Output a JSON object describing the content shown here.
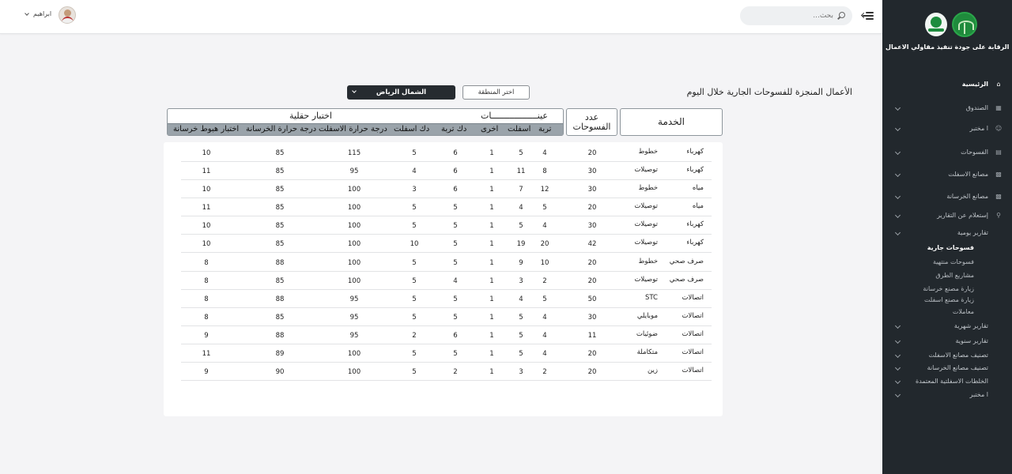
{
  "header": {
    "search_placeholder": "بحث...",
    "user_name": "ابراهيم"
  },
  "sidebar": {
    "brand_title": "الرقابة على جودة تنفيذ مقاولي الاعمال",
    "items": [
      {
        "label": "الرئيسية",
        "icon": "home-icon",
        "chevron": false
      },
      {
        "label": "الصندوق",
        "icon": "box-icon",
        "chevron": true
      },
      {
        "label": "ا مختبر",
        "icon": "lab-icon",
        "chevron": true
      },
      {
        "label": "الفسوحات",
        "icon": "document-icon",
        "chevron": true
      },
      {
        "label": "مصانع الاسفلت",
        "icon": "factory-icon",
        "chevron": true
      },
      {
        "label": "مصانع الخرسانة",
        "icon": "factory-icon",
        "chevron": true
      },
      {
        "label": "إستعلام عن التقارير",
        "icon": "search-icon",
        "chevron": true
      },
      {
        "label": "تقارير يومية",
        "icon": "",
        "chevron": true
      }
    ],
    "sub_items": [
      {
        "label": "فسوحات جارية",
        "active": true
      },
      {
        "label": "فسوحات منتهية",
        "active": false
      },
      {
        "label": "مشاريع الطرق",
        "active": false
      },
      {
        "label": "زيارة مصنع خرسانة",
        "active": false
      },
      {
        "label": "زيارة مصنع اسفلت",
        "active": false
      },
      {
        "label": "معاملات",
        "active": false
      }
    ],
    "more_items": [
      {
        "label": "تقارير شهرية"
      },
      {
        "label": "تقارير سنوية"
      },
      {
        "label": "تصنيف مصانع الاسفلت"
      },
      {
        "label": "تصنيف مصانع الخرسانة"
      },
      {
        "label": "الخلطات الاسفلتية المعتمدة"
      },
      {
        "label": "ا مختبر"
      }
    ]
  },
  "main": {
    "title": "الأعمال المنجزة للفسوحات الجارية خلال اليوم",
    "region_button": "اختر المنطقة",
    "region_selected": "الشمال الرياض",
    "headers": {
      "service": "الخدمة",
      "count_line1": "عدد",
      "count_line2": "الفسوحات",
      "samples": "عينــــــــــــــــــات",
      "field_tests": "اختبار حقلية",
      "sub": [
        "تربة",
        "اسفلت",
        "اخرى",
        "دك تربة",
        "دك اسفلت",
        "درجة حرارة الاسفلت",
        "درجة حرارة الخرسانة",
        "اختبار هبوط خرسانة"
      ]
    },
    "rows": [
      {
        "service": "كهرباء",
        "type": "خطوط",
        "count": "20",
        "soil": "4",
        "asphalt": "5",
        "other": "1",
        "soil_comp": "6",
        "asph_comp": "5",
        "asph_temp": "115",
        "conc_temp": "85",
        "slump": "10"
      },
      {
        "service": "كهرباء",
        "type": "توصيلات",
        "count": "30",
        "soil": "8",
        "asphalt": "11",
        "other": "1",
        "soil_comp": "6",
        "asph_comp": "4",
        "asph_temp": "95",
        "conc_temp": "85",
        "slump": "11"
      },
      {
        "service": "مياه",
        "type": "خطوط",
        "count": "30",
        "soil": "12",
        "asphalt": "7",
        "other": "1",
        "soil_comp": "6",
        "asph_comp": "3",
        "asph_temp": "100",
        "conc_temp": "85",
        "slump": "10"
      },
      {
        "service": "مياه",
        "type": "توصيلات",
        "count": "20",
        "soil": "5",
        "asphalt": "4",
        "other": "1",
        "soil_comp": "5",
        "asph_comp": "5",
        "asph_temp": "100",
        "conc_temp": "85",
        "slump": "11"
      },
      {
        "service": "كهرباء",
        "type": "توصيلات",
        "count": "30",
        "soil": "4",
        "asphalt": "5",
        "other": "1",
        "soil_comp": "5",
        "asph_comp": "5",
        "asph_temp": "100",
        "conc_temp": "85",
        "slump": "10"
      },
      {
        "service": "كهرباء",
        "type": "توصيلات",
        "count": "42",
        "soil": "20",
        "asphalt": "19",
        "other": "1",
        "soil_comp": "5",
        "asph_comp": "10",
        "asph_temp": "100",
        "conc_temp": "85",
        "slump": "10"
      },
      {
        "service": "صرف صحي",
        "type": "خطوط",
        "count": "20",
        "soil": "10",
        "asphalt": "9",
        "other": "1",
        "soil_comp": "5",
        "asph_comp": "5",
        "asph_temp": "100",
        "conc_temp": "88",
        "slump": "8"
      },
      {
        "service": "صرف صحي",
        "type": "توصيلات",
        "count": "20",
        "soil": "2",
        "asphalt": "3",
        "other": "1",
        "soil_comp": "4",
        "asph_comp": "5",
        "asph_temp": "100",
        "conc_temp": "85",
        "slump": "8"
      },
      {
        "service": "اتصالات",
        "type": "STC",
        "count": "50",
        "soil": "5",
        "asphalt": "4",
        "other": "1",
        "soil_comp": "5",
        "asph_comp": "5",
        "asph_temp": "95",
        "conc_temp": "88",
        "slump": "8"
      },
      {
        "service": "اتصالات",
        "type": "موبايلي",
        "count": "30",
        "soil": "4",
        "asphalt": "5",
        "other": "1",
        "soil_comp": "5",
        "asph_comp": "5",
        "asph_temp": "95",
        "conc_temp": "85",
        "slump": "8"
      },
      {
        "service": "اتصالات",
        "type": "ضوئيات",
        "count": "11",
        "soil": "4",
        "asphalt": "5",
        "other": "1",
        "soil_comp": "6",
        "asph_comp": "2",
        "asph_temp": "95",
        "conc_temp": "88",
        "slump": "9"
      },
      {
        "service": "اتصالات",
        "type": "متكاملة",
        "count": "20",
        "soil": "4",
        "asphalt": "5",
        "other": "1",
        "soil_comp": "5",
        "asph_comp": "5",
        "asph_temp": "100",
        "conc_temp": "89",
        "slump": "11"
      },
      {
        "service": "اتصالات",
        "type": "زين",
        "count": "20",
        "soil": "2",
        "asphalt": "3",
        "other": "1",
        "soil_comp": "2",
        "asph_comp": "5",
        "asph_temp": "100",
        "conc_temp": "90",
        "slump": "9"
      }
    ]
  },
  "colors": {
    "sidebar_bg": "#22282d",
    "accent_dark": "#262b30",
    "subheader_bg": "#9aa3aa",
    "logo_green": "#1f8b3c"
  }
}
